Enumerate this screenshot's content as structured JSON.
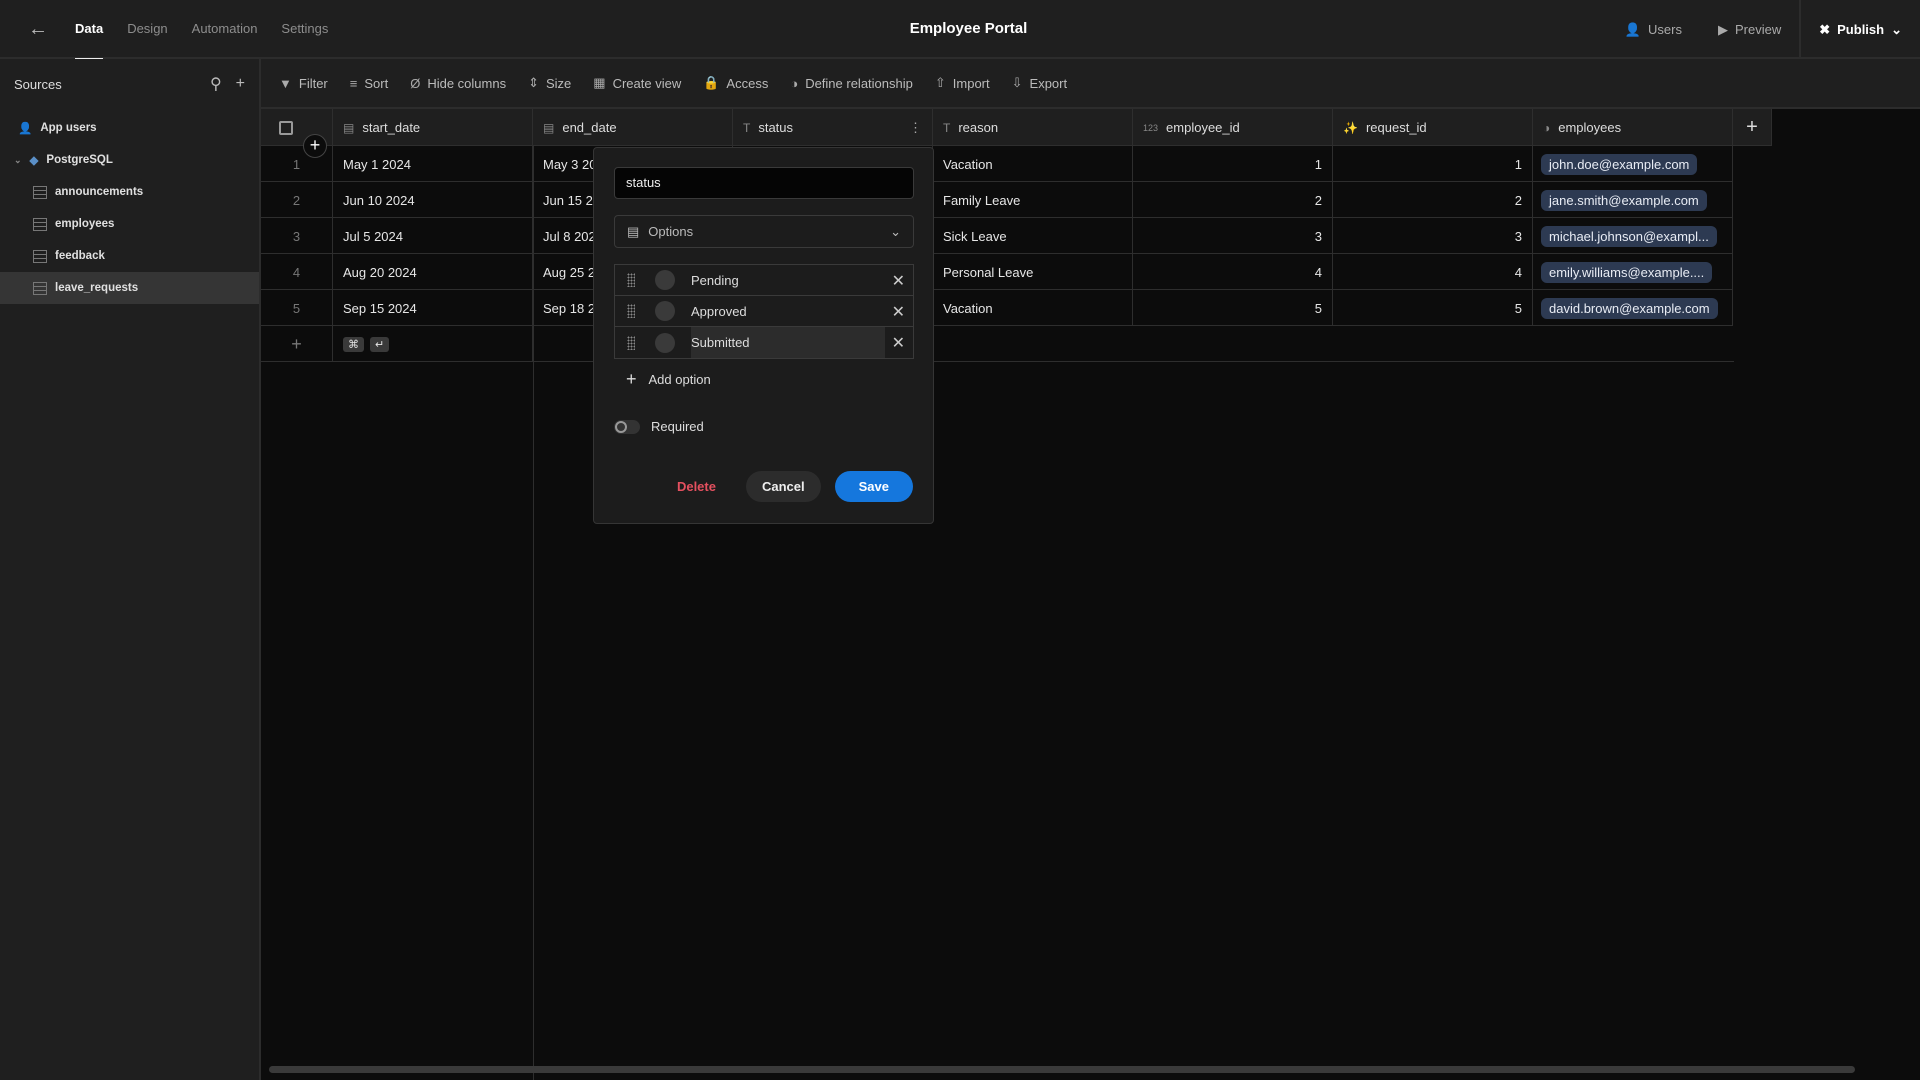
{
  "topbar": {
    "tabs": [
      "Data",
      "Design",
      "Automation",
      "Settings"
    ],
    "active_tab": "Data",
    "title": "Employee Portal",
    "users": "Users",
    "preview": "Preview",
    "publish": "Publish"
  },
  "sidebar": {
    "title": "Sources",
    "items": [
      {
        "label": "App users",
        "icon": "users-icon"
      },
      {
        "label": "PostgreSQL",
        "icon": "postgresql-icon"
      },
      {
        "label": "announcements",
        "icon": "table-icon"
      },
      {
        "label": "employees",
        "icon": "table-icon"
      },
      {
        "label": "feedback",
        "icon": "table-icon"
      },
      {
        "label": "leave_requests",
        "icon": "table-icon",
        "selected": true
      }
    ]
  },
  "toolbar": {
    "items": [
      "Filter",
      "Sort",
      "Hide columns",
      "Size",
      "Create view",
      "Access",
      "Define relationship",
      "Import",
      "Export"
    ]
  },
  "table": {
    "columns": [
      {
        "name": "start_date",
        "type": "date"
      },
      {
        "name": "end_date",
        "type": "date"
      },
      {
        "name": "status",
        "type": "text"
      },
      {
        "name": "reason",
        "type": "text"
      },
      {
        "name": "employee_id",
        "type": "number"
      },
      {
        "name": "request_id",
        "type": "auto-id"
      },
      {
        "name": "employees",
        "type": "relationship"
      }
    ],
    "rows": [
      {
        "n": "1",
        "start_date": "May 1 2024",
        "end_date": "May 3 2024",
        "status": "",
        "reason": "Vacation",
        "employee_id": "1",
        "request_id": "1",
        "employees": "john.doe@example.com"
      },
      {
        "n": "2",
        "start_date": "Jun 10 2024",
        "end_date": "Jun 15 2024",
        "status": "",
        "reason": "Family Leave",
        "employee_id": "2",
        "request_id": "2",
        "employees": "jane.smith@example.com"
      },
      {
        "n": "3",
        "start_date": "Jul 5 2024",
        "end_date": "Jul 8 2024",
        "status": "",
        "reason": "Sick Leave",
        "employee_id": "3",
        "request_id": "3",
        "employees": "michael.johnson@exampl..."
      },
      {
        "n": "4",
        "start_date": "Aug 20 2024",
        "end_date": "Aug 25 2024",
        "status": "",
        "reason": "Personal Leave",
        "employee_id": "4",
        "request_id": "4",
        "employees": "emily.williams@example...."
      },
      {
        "n": "5",
        "start_date": "Sep 15 2024",
        "end_date": "Sep 18 2024",
        "status": "",
        "reason": "Vacation",
        "employee_id": "5",
        "request_id": "5",
        "employees": "david.brown@example.com"
      }
    ]
  },
  "popup": {
    "name_value": "status",
    "type_label": "Options",
    "options": [
      "Pending",
      "Approved",
      "Submitted"
    ],
    "add_option": "Add option",
    "required_label": "Required",
    "required": false,
    "delete": "Delete",
    "cancel": "Cancel",
    "save": "Save",
    "save_color": "#1577dd",
    "delete_color": "#e4505f"
  }
}
